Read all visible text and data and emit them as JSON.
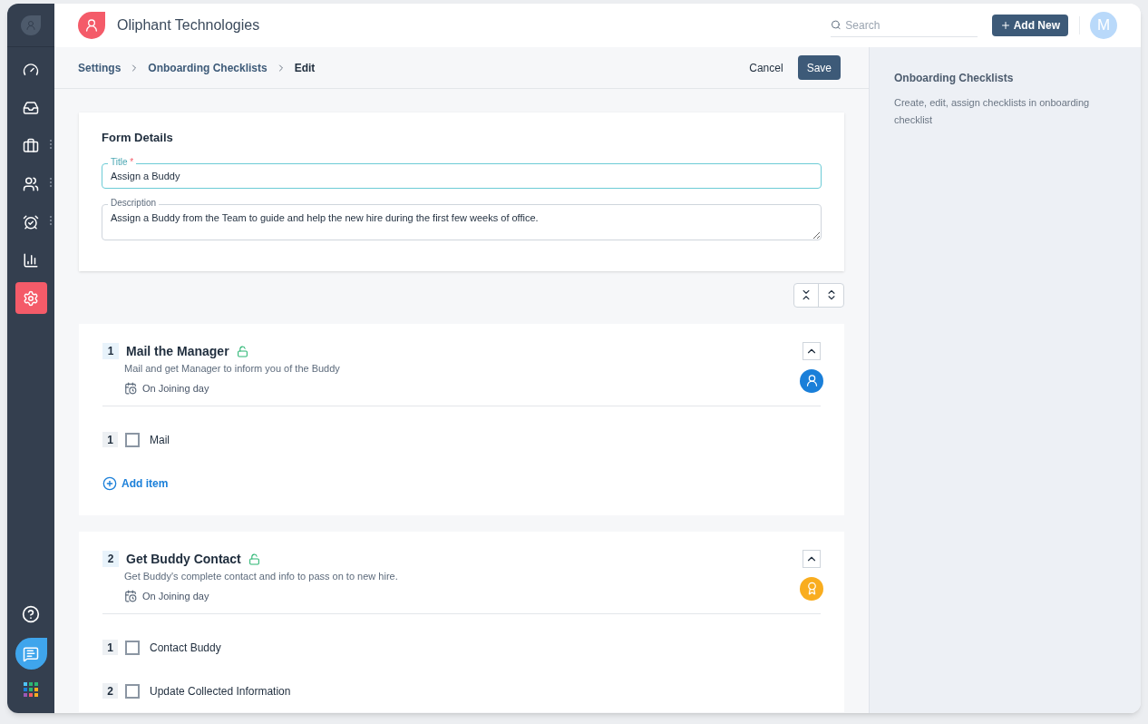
{
  "sidebar": {
    "items": [
      {
        "selected": false,
        "has_menu": false
      },
      {
        "selected": false,
        "has_menu": false
      },
      {
        "selected": false,
        "has_menu": true
      },
      {
        "selected": false,
        "has_menu": true
      },
      {
        "selected": false,
        "has_menu": true
      },
      {
        "selected": false,
        "has_menu": false
      },
      {
        "selected": true,
        "has_menu": false
      }
    ]
  },
  "header": {
    "company": "Oliphant Technologies",
    "search": {
      "placeholder": "Search"
    },
    "add_button": "Add New",
    "avatar": "M"
  },
  "breadcrumb": [
    {
      "label": "Settings",
      "current": false
    },
    {
      "label": "Onboarding Checklists",
      "current": false
    },
    {
      "label": "Edit",
      "current": true
    }
  ],
  "actions": {
    "cancel": "Cancel",
    "save": "Save"
  },
  "form": {
    "heading": "Form Details",
    "title_label": "Title",
    "required_mark": "*",
    "title_value": "Assign a Buddy",
    "description_label": "Description",
    "description_value": "Assign a Buddy from the Team to guide and help the new hire during the first few weeks of office."
  },
  "sections": [
    {
      "number": "1",
      "title": "Mail the Manager",
      "description": "Mail and get Manager to inform you of the Buddy",
      "due": "On Joining day",
      "color": "#1a7fd9",
      "kind": "assign",
      "expanded": true,
      "items": [
        {
          "number": "1",
          "label": "Mail",
          "checked": false
        }
      ],
      "add_item": "Add item"
    },
    {
      "number": "2",
      "title": "Get Buddy Contact",
      "description": "Get Buddy's complete contact and info to pass on to new hire.",
      "due": "On Joining day",
      "color": "#f9ad1f",
      "kind": "badge",
      "expanded": true,
      "items": [
        {
          "number": "1",
          "label": "Contact Buddy",
          "checked": false
        },
        {
          "number": "2",
          "label": "Update Collected Information",
          "checked": false
        }
      ]
    }
  ],
  "side_panel": {
    "title": "Onboarding Checklists",
    "text": "Create, edit, assign checklists in onboarding checklist"
  }
}
